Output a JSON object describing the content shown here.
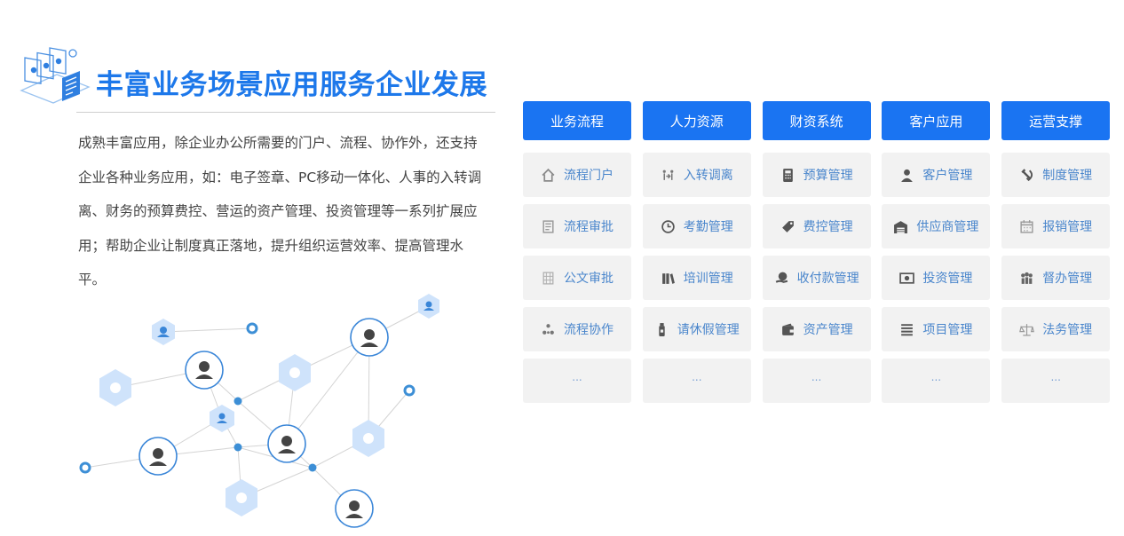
{
  "header": {
    "title": "丰富业务场景应用服务企业发展",
    "description": "成熟丰富应用，除企业办公所需要的门户、流程、协作外，还支持企业各种业务应用，如：电子签章、PC移动一体化、人事的入转调离、财务的预算费控、营运的资产管理、投资管理等一系列扩展应用；帮助企业让制度真正落地，提升组织运营效率、提高管理水平。"
  },
  "colors": {
    "accent": "#1a74f2",
    "card_bg": "#f2f2f2",
    "card_text": "#4a86cc",
    "network_node": "#3d8fd6",
    "network_hex": "#cfe3fb"
  },
  "categories": [
    {
      "tab": "业务流程",
      "items": [
        {
          "label": "流程门户",
          "icon": "home-icon"
        },
        {
          "label": "流程审批",
          "icon": "document-icon"
        },
        {
          "label": "公文审批",
          "icon": "doc-grid-icon"
        },
        {
          "label": "流程协作",
          "icon": "cluster-icon"
        },
        {
          "label": "...",
          "icon": ""
        }
      ]
    },
    {
      "tab": "人力资源",
      "items": [
        {
          "label": "入转调离",
          "icon": "people-transfer-icon"
        },
        {
          "label": "考勤管理",
          "icon": "clock-icon"
        },
        {
          "label": "培训管理",
          "icon": "books-icon"
        },
        {
          "label": "请休假管理",
          "icon": "bottle-icon"
        },
        {
          "label": "...",
          "icon": ""
        }
      ]
    },
    {
      "tab": "财资系统",
      "items": [
        {
          "label": "预算管理",
          "icon": "calculator-icon"
        },
        {
          "label": "费控管理",
          "icon": "tag-icon"
        },
        {
          "label": "收付款管理",
          "icon": "money-hand-icon"
        },
        {
          "label": "资产管理",
          "icon": "wallet-icon"
        },
        {
          "label": "...",
          "icon": ""
        }
      ]
    },
    {
      "tab": "客户应用",
      "items": [
        {
          "label": "客户管理",
          "icon": "user-icon"
        },
        {
          "label": "供应商管理",
          "icon": "warehouse-icon"
        },
        {
          "label": "投资管理",
          "icon": "banknote-icon"
        },
        {
          "label": "项目管理",
          "icon": "list-icon"
        },
        {
          "label": "...",
          "icon": ""
        }
      ]
    },
    {
      "tab": "运营支撑",
      "items": [
        {
          "label": "制度管理",
          "icon": "hammer-sickle-icon"
        },
        {
          "label": "报销管理",
          "icon": "calendar-icon"
        },
        {
          "label": "督办管理",
          "icon": "group-icon"
        },
        {
          "label": "法务管理",
          "icon": "scales-icon"
        },
        {
          "label": "...",
          "icon": ""
        }
      ]
    }
  ]
}
